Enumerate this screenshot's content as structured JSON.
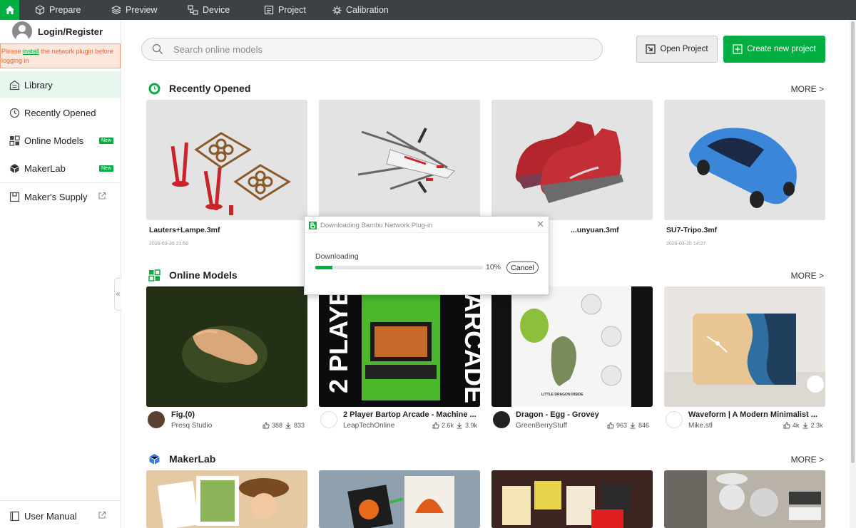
{
  "topbar": {
    "tabs": [
      {
        "label": "Prepare",
        "icon": "cube-icon"
      },
      {
        "label": "Preview",
        "icon": "layers-icon"
      },
      {
        "label": "Device",
        "icon": "device-icon"
      },
      {
        "label": "Project",
        "icon": "project-icon"
      },
      {
        "label": "Calibration",
        "icon": "calibration-icon"
      }
    ]
  },
  "sidebar": {
    "login_label": "Login/Register",
    "warning": {
      "before": "Please ",
      "link": "install",
      "after": " the network plugin before logging in"
    },
    "items": [
      {
        "label": "Library",
        "icon": "library-icon",
        "active": true
      },
      {
        "label": "Recently Opened",
        "icon": "clock-icon"
      },
      {
        "label": "Online Models",
        "icon": "grid-icon",
        "badge": "New"
      },
      {
        "label": "MakerLab",
        "icon": "makerlab-icon",
        "badge": "New"
      },
      {
        "label": "Maker's Supply",
        "icon": "supply-icon"
      }
    ],
    "footer": {
      "label": "User Manual",
      "icon": "manual-icon"
    }
  },
  "search": {
    "placeholder": "Search online models"
  },
  "buttons": {
    "open_project": "Open Project",
    "create_project": "Create new project"
  },
  "recent": {
    "title": "Recently Opened",
    "more": "MORE >",
    "cards": [
      {
        "title": "Lauters+Lampe.3mf",
        "date": "2026-03-26 21:50"
      },
      {
        "title": "",
        "date": ""
      },
      {
        "title": "...unyuan.3mf",
        "date": ""
      },
      {
        "title": "SU7-Tripo.3mf",
        "date": "2026-03-20 14:27"
      }
    ]
  },
  "online": {
    "title": "Online Models",
    "more": "MORE >",
    "cards": [
      {
        "title": "Fig.(0)",
        "author": "Presq Studio",
        "likes": "388",
        "downloads": "833"
      },
      {
        "title": "2 Player Bartop Arcade - Machine ...",
        "author": "LeapTechOnline",
        "likes": "2.6k",
        "downloads": "3.9k",
        "image_text": "2 PLAYER",
        "image_text2": "ARCADE"
      },
      {
        "title": "Dragon - Egg - Grovey",
        "author": "GreenBerryStuff",
        "likes": "963",
        "downloads": "846",
        "image_text": "LITTLE DRAGON INSIDE"
      },
      {
        "title": "Waveform | A Modern Minimalist ...",
        "author": "Mike.stl",
        "likes": "4k",
        "downloads": "2.3k"
      }
    ]
  },
  "makerlab": {
    "title": "MakerLab",
    "more": "MORE >"
  },
  "dialog": {
    "title": "Downloading Bambu Network Plug-in",
    "status": "Downloading",
    "progress": 10,
    "percent_label": "10%",
    "cancel": "Cancel"
  },
  "colors": {
    "accent": "#00ae42",
    "topbar": "#3c4143"
  }
}
